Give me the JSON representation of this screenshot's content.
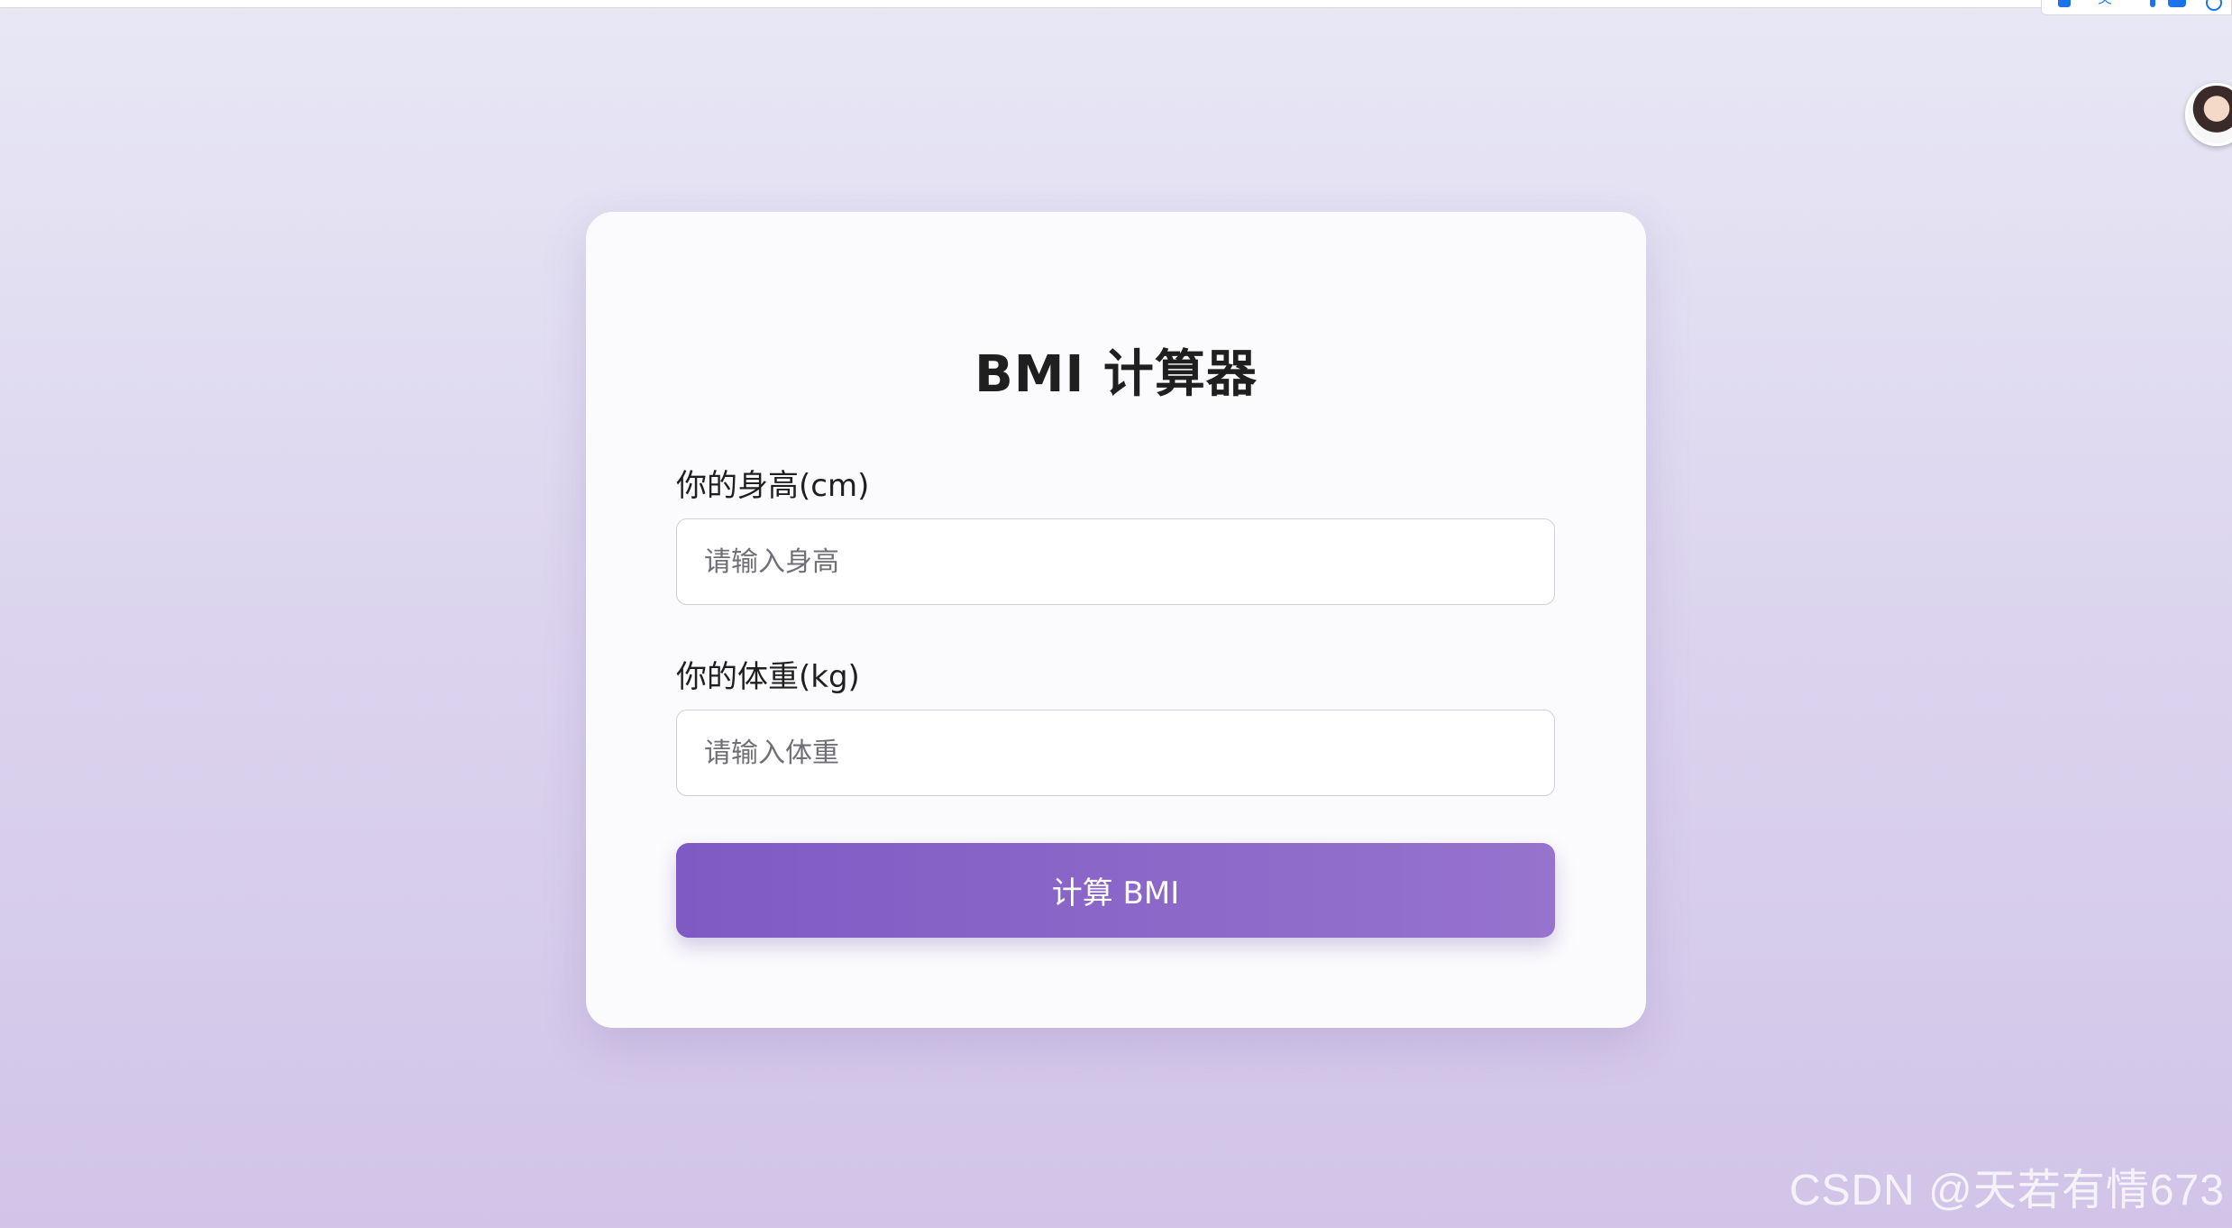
{
  "browser": {
    "widget_icons": [
      "app-icon",
      "translate-icon",
      "pin-icon",
      "tool-icon",
      "settings-icon"
    ]
  },
  "card": {
    "title": "BMI 计算器",
    "height_label": "你的身高(cm)",
    "height_placeholder": "请输入身高",
    "height_value": "",
    "weight_label": "你的体重(kg)",
    "weight_placeholder": "请输入体重",
    "weight_value": "",
    "button_label": "计算 BMI"
  },
  "watermark": "CSDN @天若有情673",
  "colors": {
    "accent": "#8560c6",
    "background_top": "#e8e8f5",
    "background_bottom": "#d1c4e8",
    "card": "#fbfbfd"
  }
}
